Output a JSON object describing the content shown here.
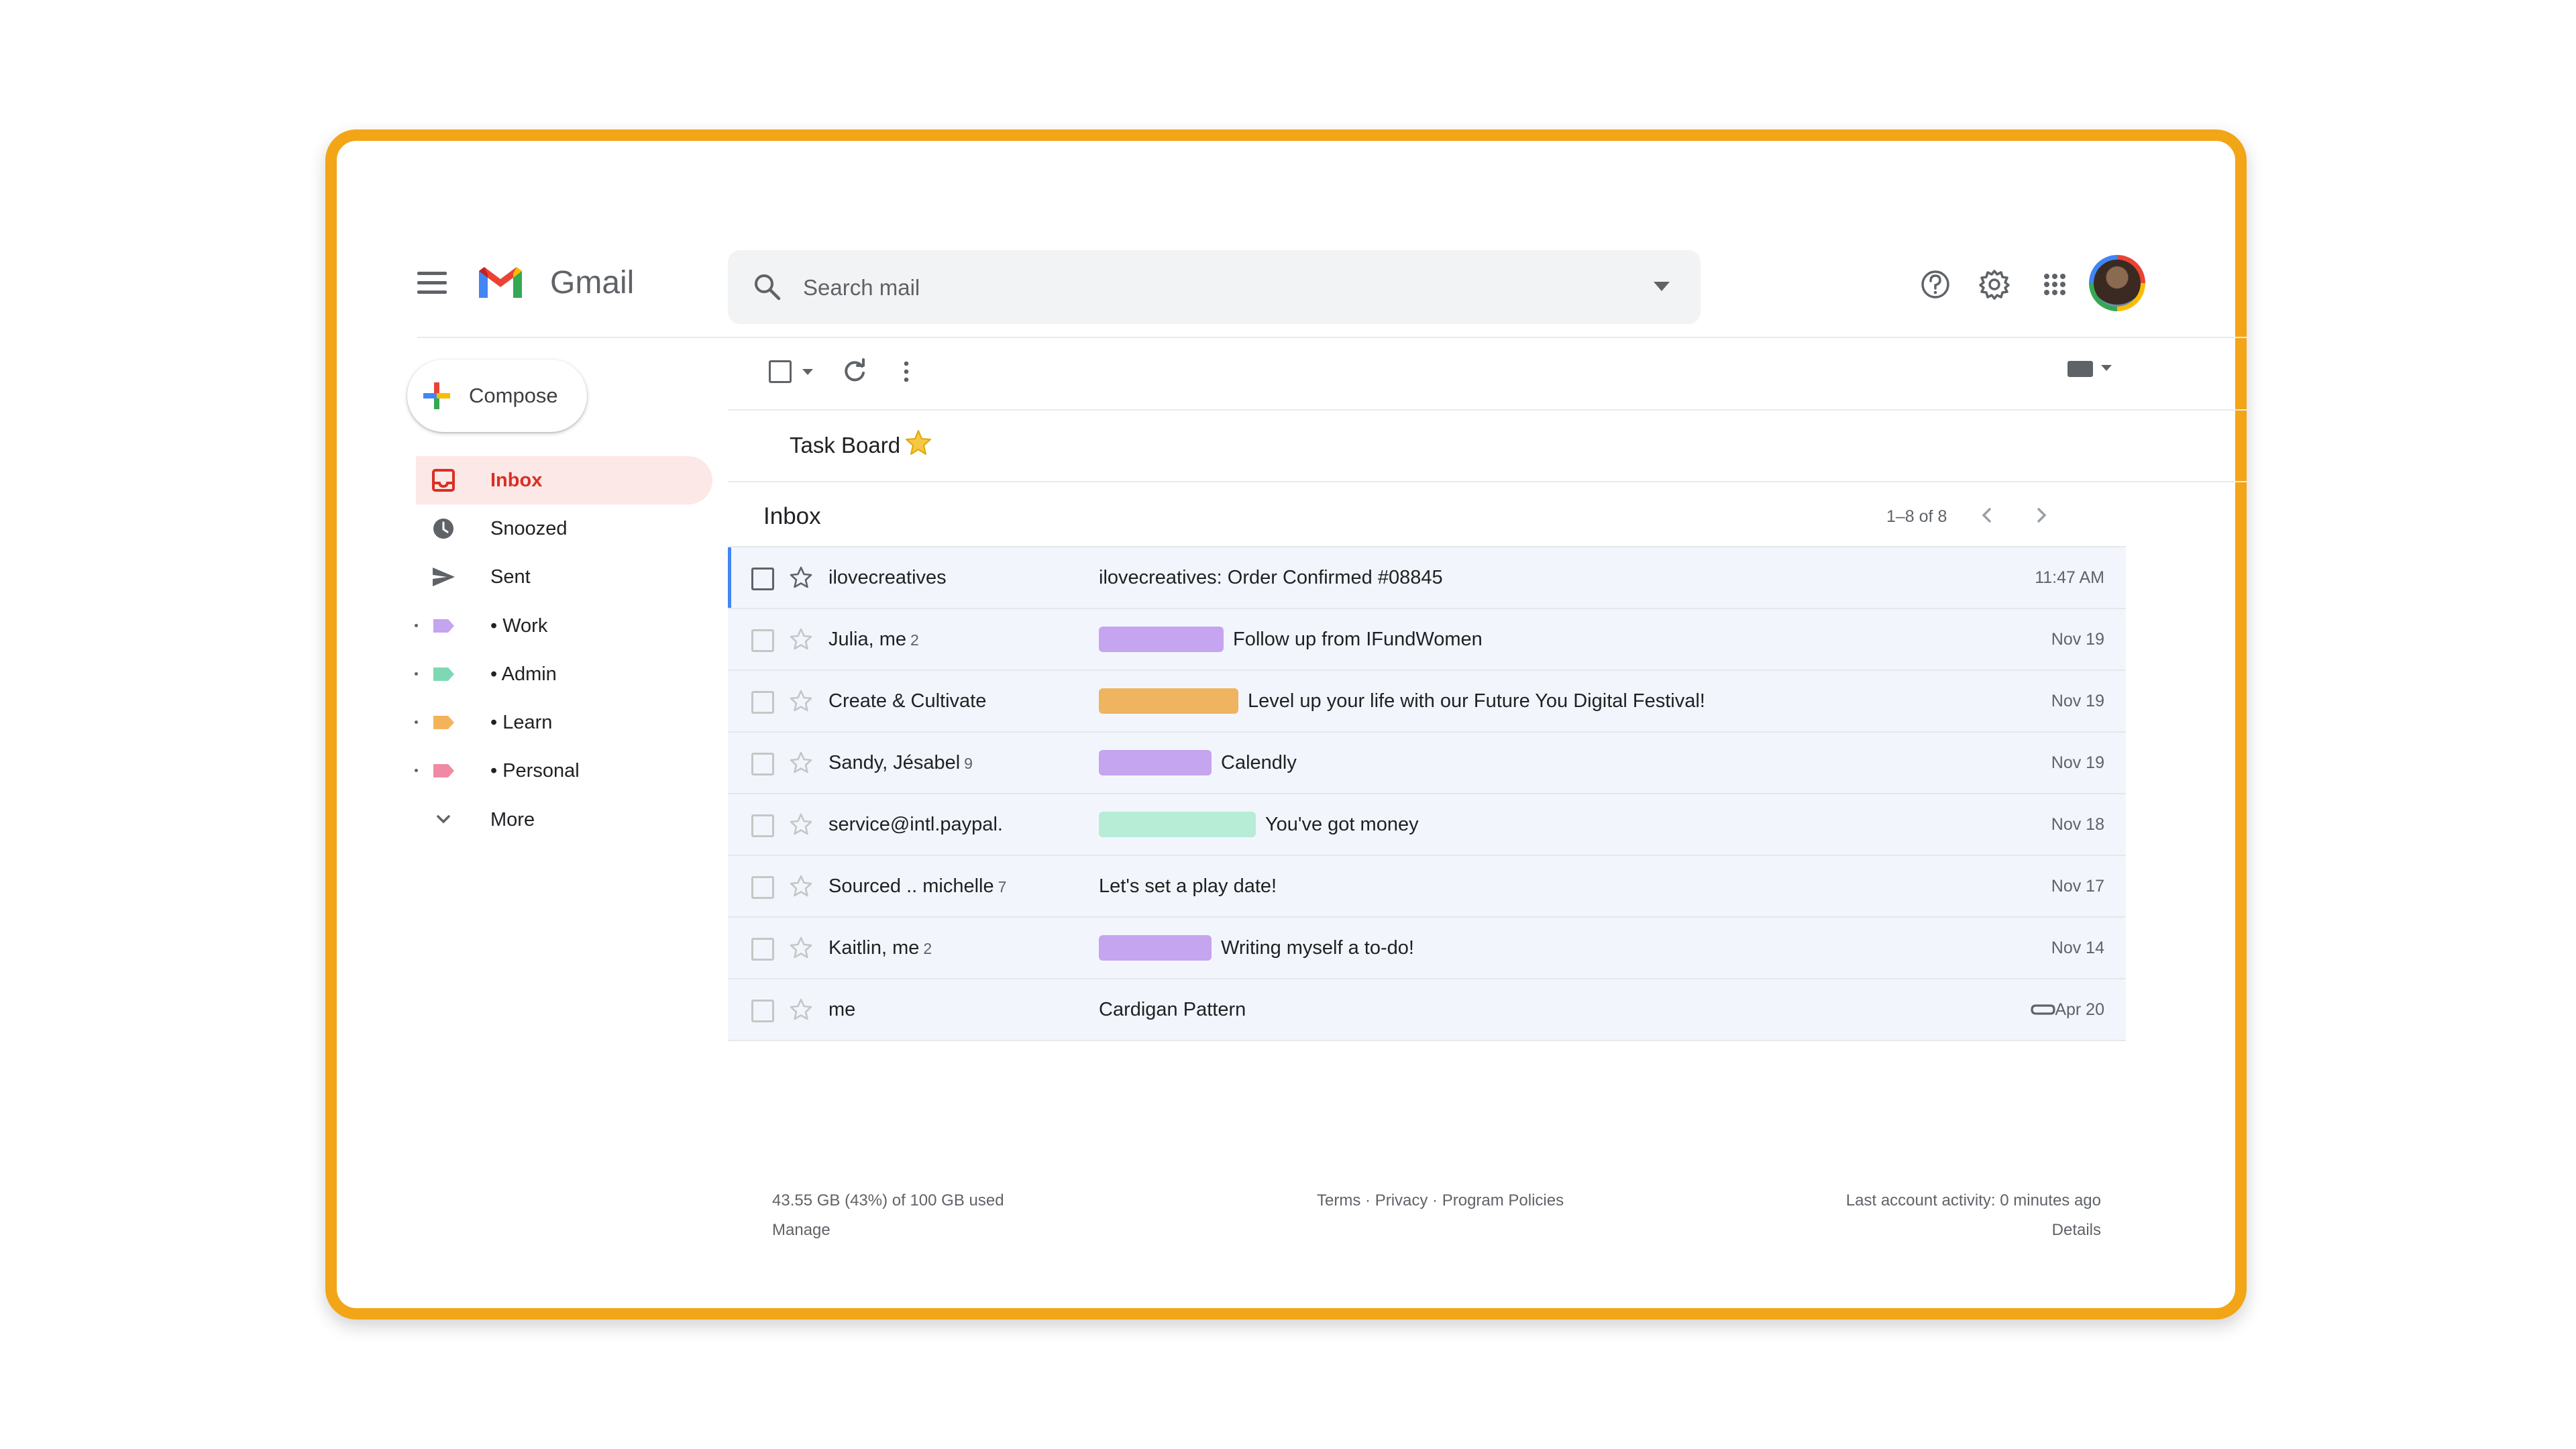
{
  "app": {
    "name": "Gmail"
  },
  "search": {
    "placeholder": "Search mail"
  },
  "compose": {
    "label": "Compose"
  },
  "sidebar": {
    "items": [
      {
        "label": "Inbox",
        "icon": "inbox-icon"
      },
      {
        "label": "Snoozed",
        "icon": "clock-icon"
      },
      {
        "label": "Sent",
        "icon": "send-icon"
      },
      {
        "label": "• Work",
        "icon": "label-icon",
        "color": "#c5a4f0"
      },
      {
        "label": "• Admin",
        "icon": "label-icon",
        "color": "#7fd8b4"
      },
      {
        "label": "• Learn",
        "icon": "label-icon",
        "color": "#f4b35a"
      },
      {
        "label": "• Personal",
        "icon": "label-icon",
        "color": "#f08aa4"
      },
      {
        "label": "More",
        "icon": "chevron-down-icon"
      }
    ]
  },
  "task_board": {
    "title": "Task Board",
    "icon": "star-icon"
  },
  "inbox": {
    "title": "Inbox",
    "range": "1–8 of 8",
    "emails": [
      {
        "sender": "ilovecreatives",
        "count": "",
        "subject": "ilovecreatives: Order Confirmed #08845",
        "date": "11:47 AM",
        "label_color": "",
        "attachment": false
      },
      {
        "sender": "Julia, me",
        "count": "2",
        "subject": "Follow up from IFundWomen",
        "date": "Nov 19",
        "label_color": "#c5a4f0",
        "attachment": false
      },
      {
        "sender": "Create & Cultivate",
        "count": "",
        "subject": "Level up your life with our Future You Digital Festival!",
        "date": "Nov 19",
        "label_color": "#efb45f",
        "attachment": false
      },
      {
        "sender": "Sandy, Jésabel",
        "count": "9",
        "subject": "Calendly",
        "date": "Nov 19",
        "label_color": "#c5a4f0",
        "attachment": false
      },
      {
        "sender": "service@intl.paypal.",
        "count": "",
        "subject": "You've got money",
        "date": "Nov 18",
        "label_color": "#b7ecd6",
        "attachment": false
      },
      {
        "sender": "Sourced .. michelle",
        "count": "7",
        "subject": "Let's set a play date!",
        "date": "Nov 17",
        "label_color": "",
        "attachment": false
      },
      {
        "sender": "Kaitlin, me",
        "count": "2",
        "subject": "Writing myself a to-do!",
        "date": "Nov 14",
        "label_color": "#c5a4f0",
        "attachment": false
      },
      {
        "sender": "me",
        "count": "",
        "subject": "Cardigan Pattern",
        "date": "Apr 20",
        "label_color": "",
        "attachment": true
      }
    ]
  },
  "footer": {
    "storage": "43.55 GB (43%) of 100 GB used",
    "manage": "Manage",
    "terms": "Terms",
    "privacy": "Privacy",
    "policies": "Program Policies",
    "separator": "·",
    "activity": "Last account activity: 0 minutes ago",
    "details": "Details"
  },
  "colors": {
    "frame": "#f2a516",
    "active": "#d93025",
    "active_bg": "#fce8e6"
  }
}
